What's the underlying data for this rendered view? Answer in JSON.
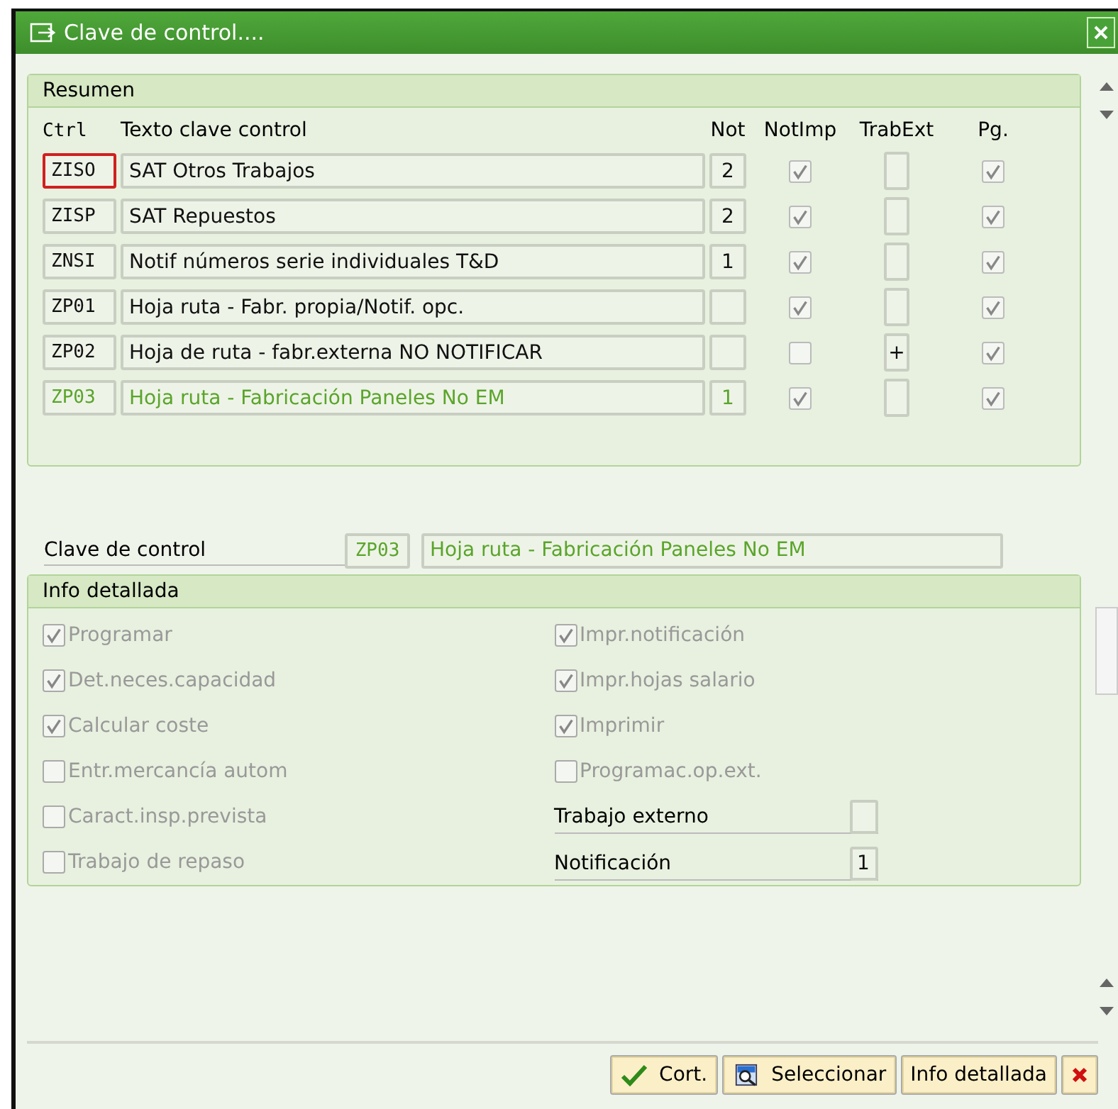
{
  "window": {
    "title": "Clave de control...."
  },
  "resumen": {
    "title": "Resumen",
    "columns": [
      "Ctrl",
      "Texto clave control",
      "Not",
      "NotImp",
      "TrabExt",
      "Pg."
    ],
    "rows": [
      {
        "code": "ZISO",
        "text": "SAT Otros Trabajos",
        "not": "2",
        "notimp": true,
        "pg": true,
        "focused": true,
        "selected": false
      },
      {
        "code": "ZISP",
        "text": "SAT Repuestos",
        "not": "2",
        "notimp": true,
        "pg": true,
        "focused": false,
        "selected": false
      },
      {
        "code": "ZNSI",
        "text": "Notif números serie individuales T&D",
        "not": "1",
        "notimp": true,
        "pg": true,
        "focused": false,
        "selected": false
      },
      {
        "code": "ZP01",
        "text": "Hoja ruta - Fabr. propia/Notif. opc.",
        "notimp": true,
        "pg": true,
        "focused": false,
        "selected": false
      },
      {
        "code": "ZP02",
        "text": "Hoja de ruta - fabr.externa NO NOTIFICAR",
        "trabext": "+",
        "notimp": false,
        "pg": true,
        "focused": false,
        "selected": false
      },
      {
        "code": "ZP03",
        "text": "Hoja ruta - Fabricación Paneles  No EM",
        "not": "1",
        "notimp": true,
        "pg": true,
        "focused": false,
        "selected": true
      }
    ]
  },
  "clave": {
    "label": "Clave de control",
    "code": "ZP03",
    "text": "Hoja ruta - Fabricación Paneles  No EM"
  },
  "detalle": {
    "title": "Info detallada",
    "left": [
      {
        "label": "Programar",
        "checked": true
      },
      {
        "label": "Det.neces.capacidad",
        "checked": true
      },
      {
        "label": "Calcular coste",
        "checked": true
      },
      {
        "label": "Entr.mercancía autom",
        "checked": false
      },
      {
        "label": "Caract.insp.prevista",
        "checked": false
      },
      {
        "label": "Trabajo de repaso",
        "checked": false
      }
    ],
    "right": [
      {
        "label": "Impr.notificación",
        "checked": true
      },
      {
        "label": "Impr.hojas salario",
        "checked": true
      },
      {
        "label": "Imprimir",
        "checked": true
      },
      {
        "label": "Programac.op.ext.",
        "checked": false
      }
    ],
    "fields": [
      {
        "label": "Trabajo externo"
      },
      {
        "label": "Notificación",
        "value": "1"
      }
    ]
  },
  "buttons": [
    {
      "kind": "ok",
      "label": "Cort."
    },
    {
      "kind": "select",
      "label": "Seleccionar"
    },
    {
      "kind": "plain",
      "label": "Info detallada"
    },
    {
      "kind": "cancel"
    }
  ]
}
